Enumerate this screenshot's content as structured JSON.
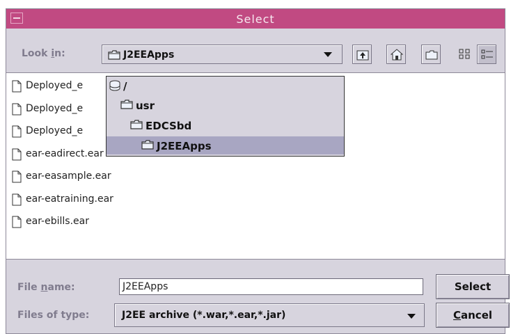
{
  "window": {
    "title": "Select"
  },
  "lookin": {
    "label_pre": "Look ",
    "label_mnemonic": "i",
    "label_post": "n:",
    "value": "J2EEApps"
  },
  "toolbar": {
    "buttons": [
      {
        "icon": "up-folder-icon"
      },
      {
        "icon": "home-icon"
      },
      {
        "icon": "new-folder-icon"
      },
      {
        "icon": "list-view-icon"
      },
      {
        "icon": "details-view-icon"
      }
    ]
  },
  "dropdown": {
    "items": [
      {
        "label": "/",
        "icon": "drive-icon"
      },
      {
        "label": "usr",
        "icon": "folder-icon"
      },
      {
        "label": "EDCSbd",
        "icon": "folder-icon"
      },
      {
        "label": "J2EEApps",
        "icon": "folder-icon",
        "selected": true
      }
    ]
  },
  "files": [
    "Deployed_e",
    "Deployed_e",
    "Deployed_e",
    "ear-eadirect.ear",
    "ear-easample.ear",
    "ear-eatraining.ear",
    "ear-ebills.ear"
  ],
  "filename": {
    "label_pre": "File ",
    "label_mnemonic": "n",
    "label_post": "ame:",
    "value": "J2EEApps"
  },
  "filetype": {
    "label": "Files of type:",
    "value": "J2EE archive (*.war,*.ear,*.jar)"
  },
  "buttons": {
    "select": "Select",
    "cancel_mnemonic": "C",
    "cancel_rest": "ancel"
  },
  "colors": {
    "titlebar": "#c14a82",
    "selection": "#a8a6c2",
    "dialog_bg": "#d7d4de"
  }
}
